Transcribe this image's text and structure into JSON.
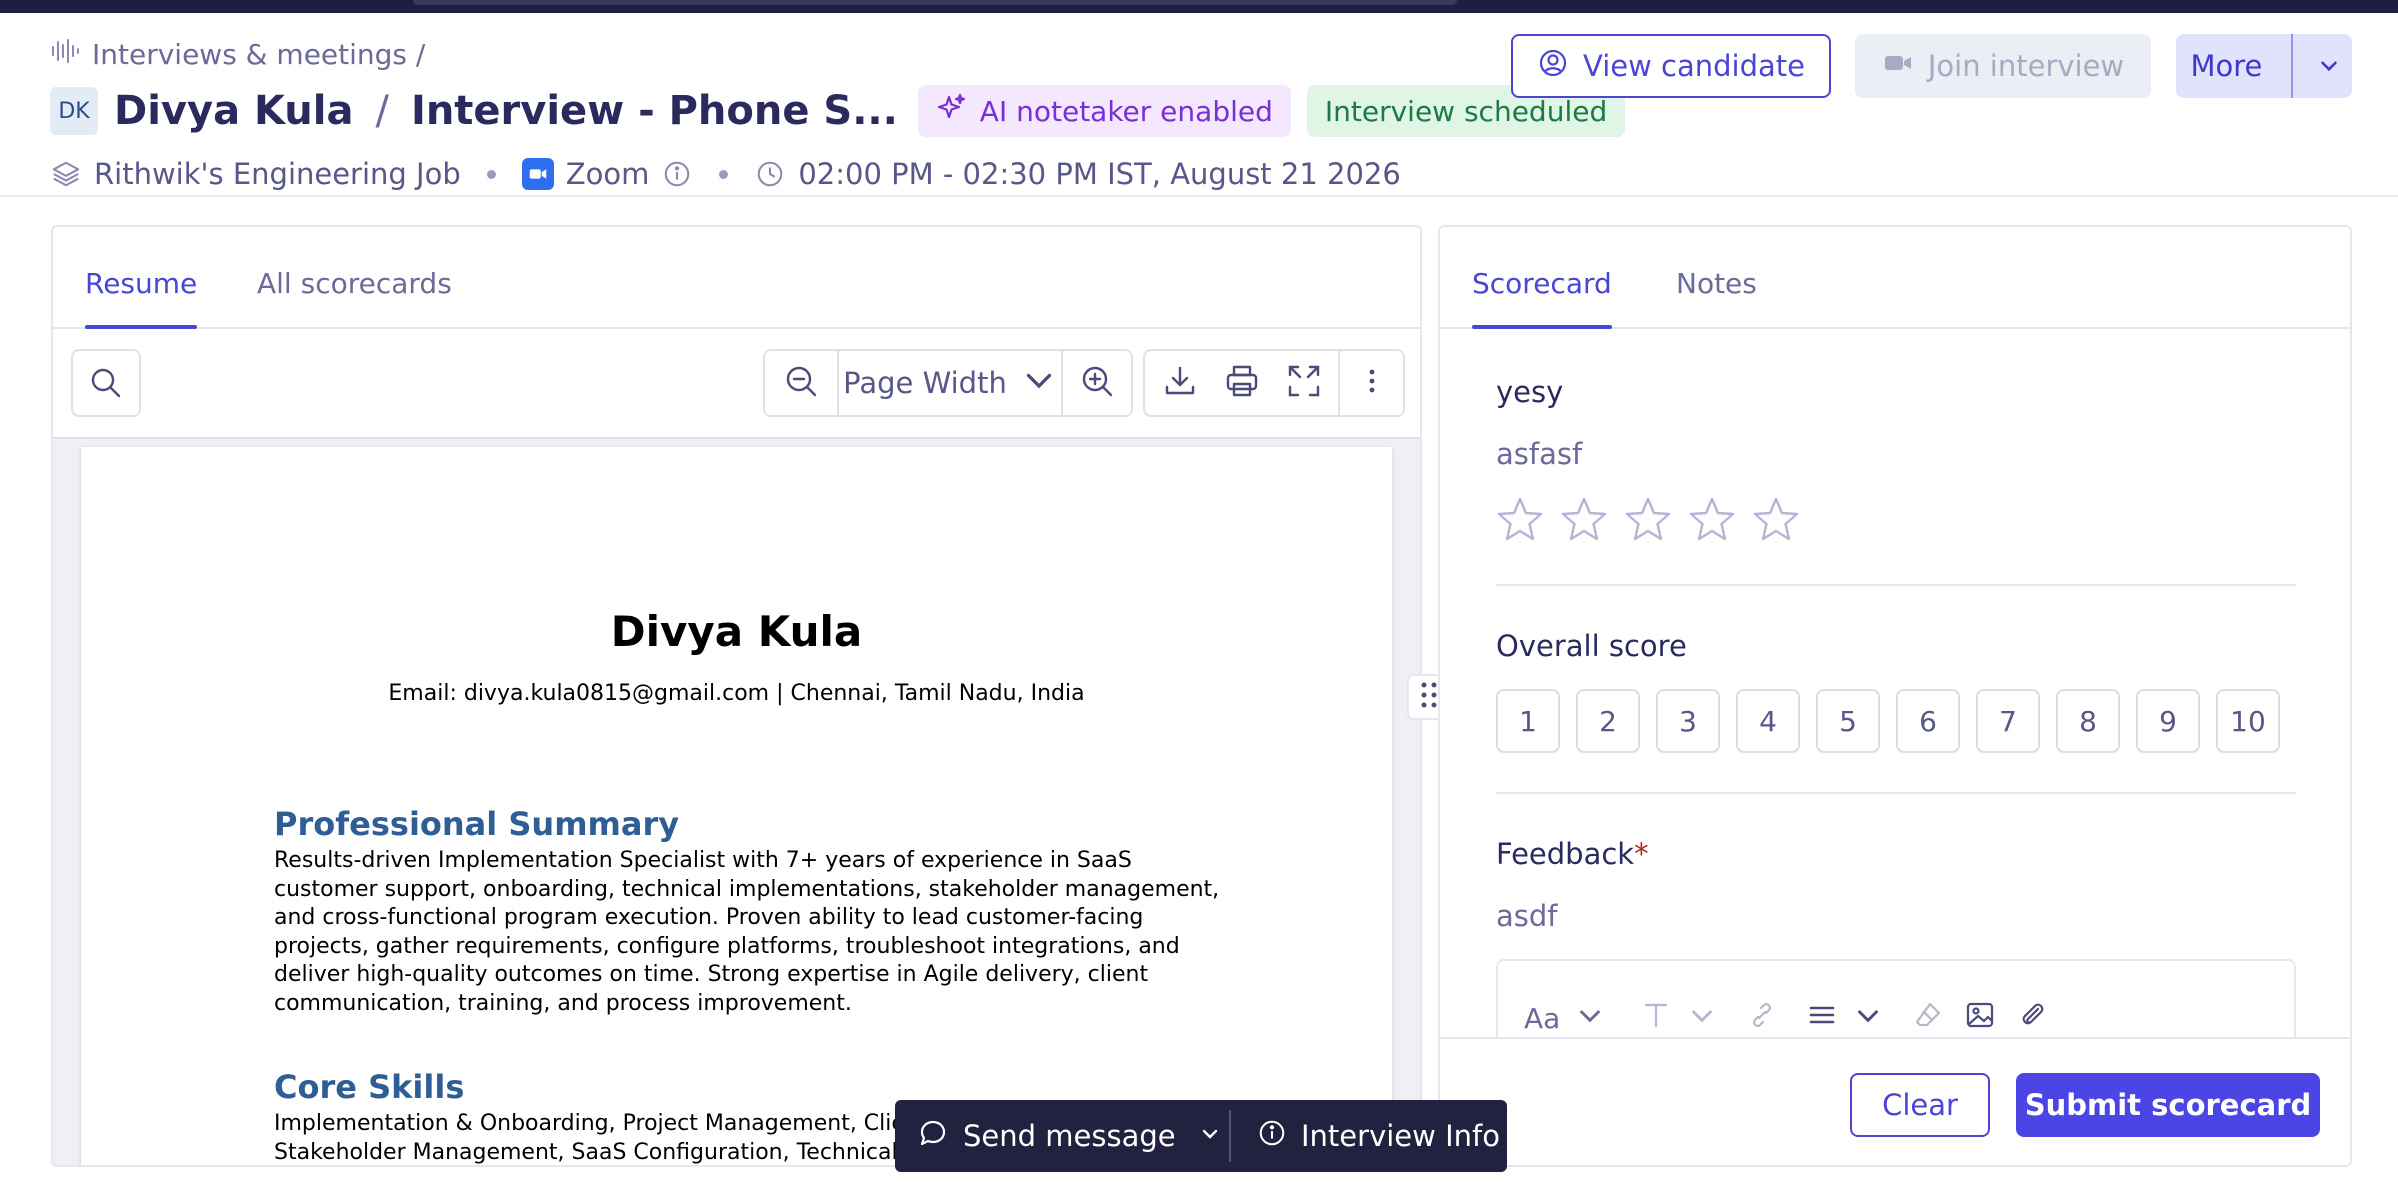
{
  "breadcrumb": {
    "label": "Interviews & meetings /"
  },
  "header": {
    "avatar_initials": "DK",
    "candidate_name": "Divya Kula",
    "separator": "/",
    "interview_title": "Interview - Phone S...",
    "badge_ai": "AI notetaker enabled",
    "badge_status": "Interview scheduled",
    "job": "Rithwik's Engineering Job",
    "platform": "Zoom",
    "time": "02:00 PM - 02:30 PM IST, August 21 2026",
    "view_candidate_label": "View candidate",
    "join_interview_label": "Join interview",
    "more_label": "More"
  },
  "left_tabs": [
    {
      "label": "Resume",
      "active": true
    },
    {
      "label": "All scorecards",
      "active": false
    }
  ],
  "viewer": {
    "zoom_mode": "Page Width"
  },
  "resume": {
    "name": "Divya Kula",
    "contact": "Email: divya.kula0815@gmail.com | Chennai, Tamil Nadu, India",
    "summary_heading": "Professional Summary",
    "summary_lines": [
      "Results-driven Implementation Specialist with 7+ years of experience in SaaS",
      "customer support, onboarding, technical implementations, stakeholder management,",
      "and cross-functional program execution. Proven ability to lead customer-facing",
      "projects, gather requirements, configure platforms, troubleshoot integrations, and",
      "deliver high-quality outcomes on time. Strong expertise in Agile delivery, client",
      "communication, training, and process improvement."
    ],
    "skills_heading": "Core Skills",
    "skills_lines": [
      "Implementation & Onboarding, Project Management, Clier",
      "Stakeholder Management, SaaS Configuration, Technical T"
    ]
  },
  "float_bar": {
    "send_label": "Send message",
    "info_label": "Interview Info"
  },
  "right_tabs": [
    {
      "label": "Scorecard",
      "active": true
    },
    {
      "label": "Notes",
      "active": false
    }
  ],
  "scorecard": {
    "question_title": "yesy",
    "question_desc": "asfasf",
    "star_rating": {
      "value": 0,
      "max": 5
    },
    "overall_label": "Overall score",
    "scores": [
      "1",
      "2",
      "3",
      "4",
      "5",
      "6",
      "7",
      "8",
      "9",
      "10"
    ],
    "feedback_label": "Feedback",
    "required_mark": "*",
    "feedback_desc": "asdf",
    "editor_font_label": "Aa",
    "clear_label": "Clear",
    "submit_label": "Submit scorecard"
  },
  "colors": {
    "accent": "#4b45d6",
    "navy": "#22213f",
    "ai_badge": "#7a2ed6",
    "status_badge": "#1d7a42",
    "heading_blue": "#2f5e96"
  }
}
